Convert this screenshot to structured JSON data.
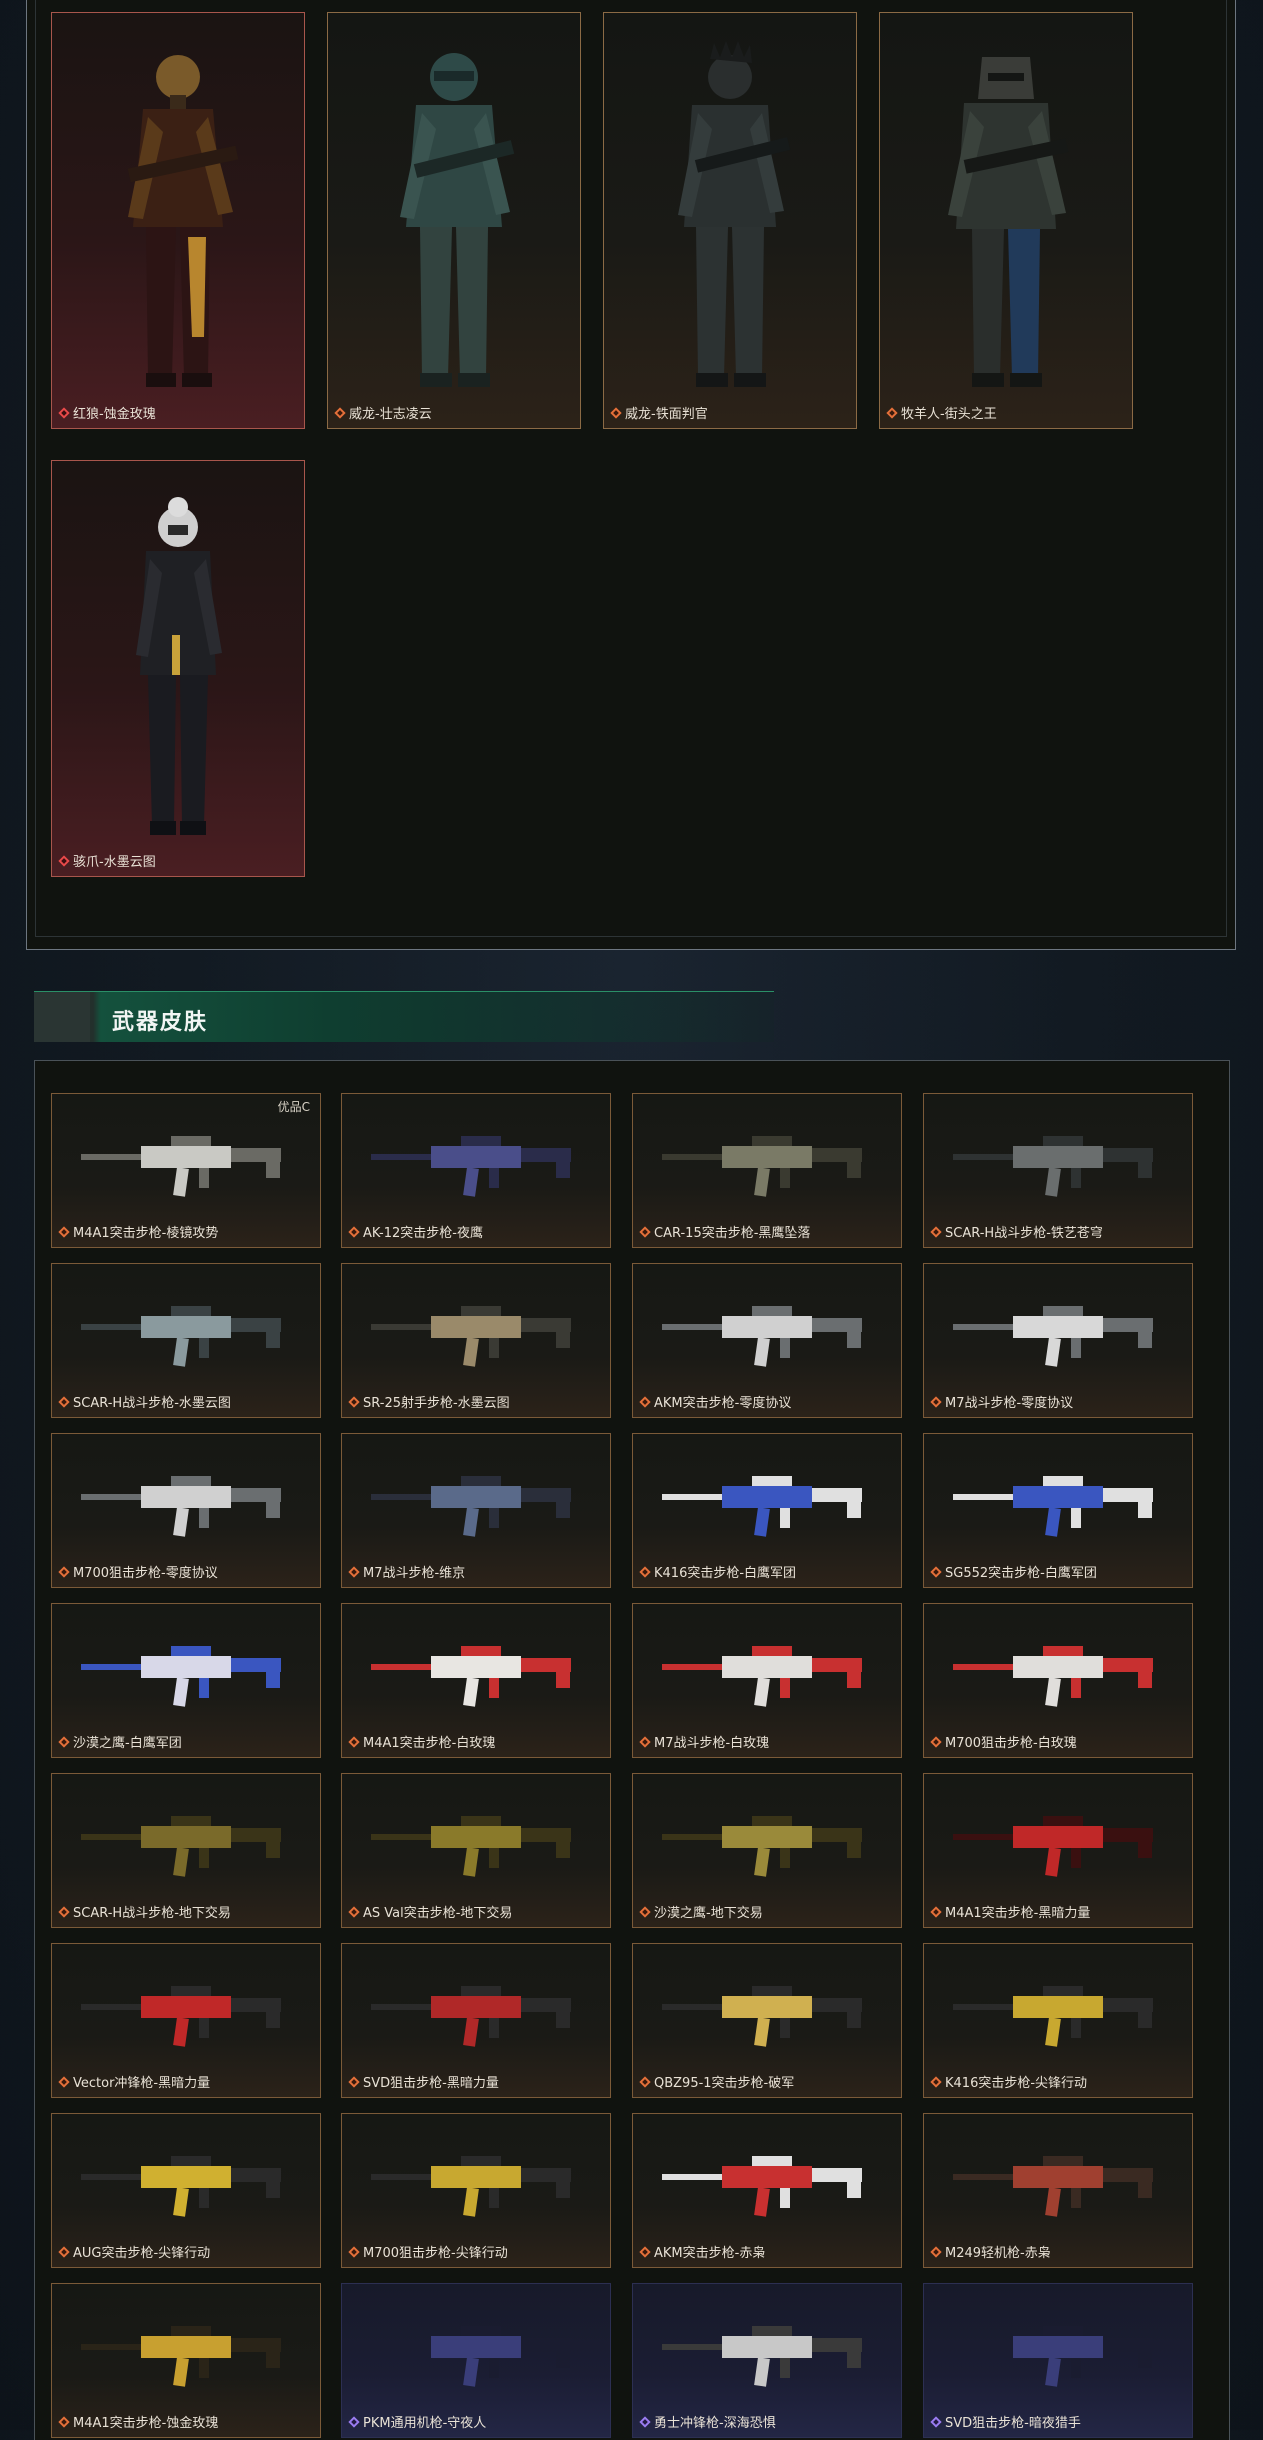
{
  "operators": [
    {
      "name": "红狼-蚀金玫瑰",
      "rarity": "red"
    },
    {
      "name": "威龙-壮志凌云",
      "rarity": "gold"
    },
    {
      "name": "威龙-铁面判官",
      "rarity": "gold"
    },
    {
      "name": "牧羊人-街头之王",
      "rarity": "gold"
    },
    {
      "name": "骇爪-水墨云图",
      "rarity": "red"
    }
  ],
  "weapons_section": {
    "title": "武器皮肤"
  },
  "weapons": [
    {
      "name": "M4A1突击步枪-棱镜攻势",
      "rarity": "gold",
      "badge": "优品C"
    },
    {
      "name": "AK-12突击步枪-夜鹰",
      "rarity": "gold"
    },
    {
      "name": "CAR-15突击步枪-黑鹰坠落",
      "rarity": "gold"
    },
    {
      "name": "SCAR-H战斗步枪-铁艺苍穹",
      "rarity": "gold"
    },
    {
      "name": "SCAR-H战斗步枪-水墨云图",
      "rarity": "gold"
    },
    {
      "name": "SR-25射手步枪-水墨云图",
      "rarity": "gold"
    },
    {
      "name": "AKM突击步枪-零度协议",
      "rarity": "gold"
    },
    {
      "name": "M7战斗步枪-零度协议",
      "rarity": "gold"
    },
    {
      "name": "M700狙击步枪-零度协议",
      "rarity": "gold"
    },
    {
      "name": "M7战斗步枪-维京",
      "rarity": "gold"
    },
    {
      "name": "K416突击步枪-白鹰军团",
      "rarity": "gold"
    },
    {
      "name": "SG552突击步枪-白鹰军团",
      "rarity": "gold"
    },
    {
      "name": "沙漠之鹰-白鹰军团",
      "rarity": "gold"
    },
    {
      "name": "M4A1突击步枪-白玫瑰",
      "rarity": "gold"
    },
    {
      "name": "M7战斗步枪-白玫瑰",
      "rarity": "gold"
    },
    {
      "name": "M700狙击步枪-白玫瑰",
      "rarity": "gold"
    },
    {
      "name": "SCAR-H战斗步枪-地下交易",
      "rarity": "gold"
    },
    {
      "name": "AS Val突击步枪-地下交易",
      "rarity": "gold"
    },
    {
      "name": "沙漠之鹰-地下交易",
      "rarity": "gold"
    },
    {
      "name": "M4A1突击步枪-黑暗力量",
      "rarity": "gold"
    },
    {
      "name": "Vector冲锋枪-黑暗力量",
      "rarity": "gold"
    },
    {
      "name": "SVD狙击步枪-黑暗力量",
      "rarity": "gold"
    },
    {
      "name": "QBZ95-1突击步枪-破军",
      "rarity": "gold"
    },
    {
      "name": "K416突击步枪-尖锋行动",
      "rarity": "gold"
    },
    {
      "name": "AUG突击步枪-尖锋行动",
      "rarity": "gold"
    },
    {
      "name": "M700狙击步枪-尖锋行动",
      "rarity": "gold"
    },
    {
      "name": "AKM突击步枪-赤枭",
      "rarity": "gold"
    },
    {
      "name": "M249轻机枪-赤枭",
      "rarity": "gold"
    },
    {
      "name": "M4A1突击步枪-蚀金玫瑰",
      "rarity": "gold"
    },
    {
      "name": "PKM通用机枪-守夜人",
      "rarity": "purple"
    },
    {
      "name": "勇士冲锋枪-深海恐惧",
      "rarity": "purple"
    },
    {
      "name": "SVD狙击步枪-暗夜猎手",
      "rarity": "purple"
    }
  ],
  "colors": {
    "accent": "#1b6b4f",
    "gold_border": "#8b6a45",
    "red_border": "#a8564c",
    "purple_border": "#2c2f52"
  }
}
